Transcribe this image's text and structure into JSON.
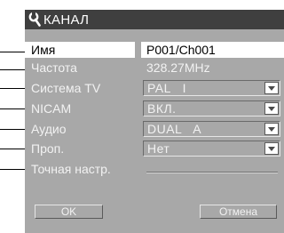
{
  "dialog": {
    "title": "КАНАЛ"
  },
  "rows": [
    {
      "label": "Имя",
      "value": "P001/Ch001"
    },
    {
      "label": "Частота",
      "value": "328.27MHz"
    },
    {
      "label": "Система TV",
      "value": "PAL   I"
    },
    {
      "label": "NICAM",
      "value": "ВКЛ."
    },
    {
      "label": "Аудио",
      "value": "DUAL   A"
    },
    {
      "label": "Проп.",
      "value": "Нет"
    },
    {
      "label": "Точная настр.",
      "value": ""
    }
  ],
  "buttons": {
    "ok": "OK",
    "cancel": "Отмена"
  },
  "colors": {
    "panel": "#a8a8a8",
    "titlebar": "#3f3f3f",
    "highlight": "#ffffff"
  },
  "icons": {
    "title": "wrench-icon",
    "dropdown": "chevron-down-icon"
  }
}
